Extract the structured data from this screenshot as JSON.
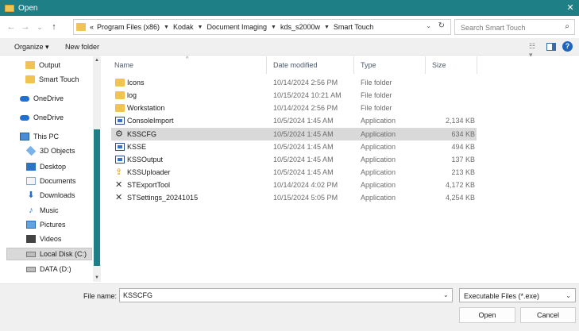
{
  "window": {
    "title": "Open",
    "close_glyph": "✕"
  },
  "nav": {
    "back_glyph": "←",
    "forward_glyph": "→",
    "recent_glyph": "⌄",
    "up_glyph": "↑",
    "overflow": "«",
    "breadcrumbs": [
      "Program Files (x86)",
      "Kodak",
      "Document Imaging",
      "kds_s2000w",
      "Smart Touch"
    ],
    "crumb_separator": "▼",
    "address_dropdown_glyph": "⌄",
    "refresh_glyph": "↻",
    "search_placeholder": "Search Smart Touch",
    "search_icon_glyph": "⌕"
  },
  "toolbar": {
    "organize_label": "Organize ▾",
    "new_folder_label": "New folder",
    "view_glyph": "☷ ▾",
    "help_glyph": "?"
  },
  "sidebar": {
    "items": [
      {
        "label": "Output",
        "icon": "folder-icon"
      },
      {
        "label": "Smart Touch",
        "icon": "folder-icon"
      },
      {
        "label": "OneDrive",
        "icon": "cloud-icon"
      },
      {
        "label": "OneDrive",
        "icon": "cloud-icon"
      },
      {
        "label": "This PC",
        "icon": "computer-icon"
      },
      {
        "label": "3D Objects",
        "icon": "cube-icon"
      },
      {
        "label": "Desktop",
        "icon": "desktop-icon"
      },
      {
        "label": "Documents",
        "icon": "documents-icon"
      },
      {
        "label": "Downloads",
        "icon": "download-icon"
      },
      {
        "label": "Music",
        "icon": "music-icon"
      },
      {
        "label": "Pictures",
        "icon": "pictures-icon"
      },
      {
        "label": "Videos",
        "icon": "videos-icon"
      },
      {
        "label": "Local Disk (C:)",
        "icon": "drive-icon",
        "selected": true
      },
      {
        "label": "DATA (D:)",
        "icon": "drive-icon"
      }
    ],
    "scroll_up_glyph": "▲",
    "scroll_down_glyph": "▼"
  },
  "columns": {
    "name": "Name",
    "date": "Date modified",
    "type": "Type",
    "size": "Size",
    "sort_glyph": "^"
  },
  "files": [
    {
      "name": "Icons",
      "date": "10/14/2024 2:56 PM",
      "type": "File folder",
      "size": "",
      "icon": "folder-icon"
    },
    {
      "name": "log",
      "date": "10/15/2024 10:21 AM",
      "type": "File folder",
      "size": "",
      "icon": "folder-icon"
    },
    {
      "name": "Workstation",
      "date": "10/14/2024 2:56 PM",
      "type": "File folder",
      "size": "",
      "icon": "folder-icon"
    },
    {
      "name": "ConsoleImport",
      "date": "10/5/2024 1:45 AM",
      "type": "Application",
      "size": "2,134 KB",
      "icon": "application-icon"
    },
    {
      "name": "KSSCFG",
      "date": "10/5/2024 1:45 AM",
      "type": "Application",
      "size": "634 KB",
      "icon": "config-tool-icon",
      "selected": true
    },
    {
      "name": "KSSE",
      "date": "10/5/2024 1:45 AM",
      "type": "Application",
      "size": "494 KB",
      "icon": "application-icon"
    },
    {
      "name": "KSSOutput",
      "date": "10/5/2024 1:45 AM",
      "type": "Application",
      "size": "137 KB",
      "icon": "application-icon"
    },
    {
      "name": "KSSUploader",
      "date": "10/5/2024 1:45 AM",
      "type": "Application",
      "size": "213 KB",
      "icon": "upload-icon"
    },
    {
      "name": "STExportTool",
      "date": "10/14/2024 4:02 PM",
      "type": "Application",
      "size": "4,172 KB",
      "icon": "tools-icon"
    },
    {
      "name": "STSettings_20241015",
      "date": "10/15/2024 5:05 PM",
      "type": "Application",
      "size": "4,254 KB",
      "icon": "tools-icon"
    }
  ],
  "footer": {
    "file_name_label": "File name:",
    "file_name_value": "KSSCFG",
    "file_name_dropdown_glyph": "⌄",
    "filter_value": "Executable Files (*.exe)",
    "filter_dropdown_glyph": "⌄",
    "open_label": "Open",
    "cancel_label": "Cancel"
  },
  "colors": {
    "titlebar": "#1f7f86",
    "selection": "#d9d9d9",
    "folder": "#f1c451",
    "accent_blue": "#1e63c2"
  }
}
